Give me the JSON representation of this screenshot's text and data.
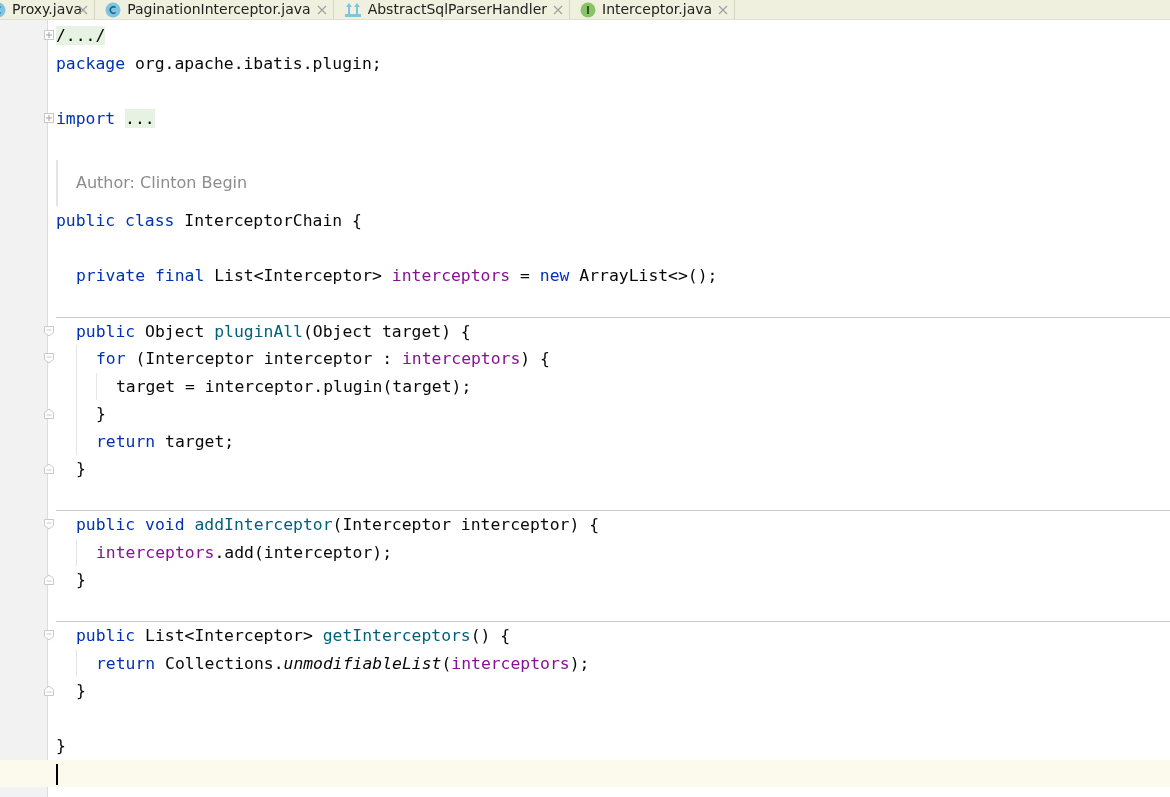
{
  "tabs": [
    {
      "label": "Proxy.java",
      "kind": "class"
    },
    {
      "label": "PaginationInterceptor.java",
      "kind": "class"
    },
    {
      "label": "AbstractSqlParserHandler",
      "kind": "abstract_class"
    },
    {
      "label": "Interceptor.java",
      "kind": "interface"
    }
  ],
  "lines": [
    {
      "kind": "folded",
      "tokens": [
        {
          "t": "/.../",
          "kind": "placeholder"
        }
      ]
    },
    {
      "kind": "code",
      "tokens": [
        {
          "t": "package",
          "kind": "keyword"
        },
        {
          "t": " org.apache.ibatis.plugin;",
          "kind": "plain"
        }
      ]
    },
    {
      "kind": "blank"
    },
    {
      "kind": "folded",
      "tokens": [
        {
          "t": "import ",
          "kind": "keyword"
        },
        {
          "t": "...",
          "kind": "placeholder"
        }
      ]
    },
    {
      "kind": "blank"
    },
    {
      "kind": "doc",
      "text": "Author: Clinton Begin"
    },
    {
      "kind": "scope",
      "tokens": [
        {
          "t": "public class",
          "kind": "keyword"
        },
        {
          "t": " InterceptorChain {",
          "kind": "plain"
        }
      ],
      "end": [
        {
          "t": "}",
          "kind": "plain"
        }
      ],
      "children": [
        {
          "kind": "blank"
        },
        {
          "kind": "code",
          "tokens": [
            {
              "t": "private final",
              "kind": "keyword"
            },
            {
              "t": " List<Interceptor> ",
              "kind": "plain"
            },
            {
              "t": "interceptors",
              "kind": "field"
            },
            {
              "t": " = ",
              "kind": "plain"
            },
            {
              "t": "new",
              "kind": "keyword"
            },
            {
              "t": " ArrayList<>();",
              "kind": "plain"
            }
          ]
        },
        {
          "kind": "blank"
        },
        {
          "kind": "separator"
        },
        {
          "kind": "block",
          "tokens": [
            {
              "t": "public",
              "kind": "keyword"
            },
            {
              "t": " Object ",
              "kind": "plain"
            },
            {
              "t": "pluginAll",
              "kind": "method"
            },
            {
              "t": "(Object target) {",
              "kind": "plain"
            }
          ],
          "end": [
            {
              "t": "}",
              "kind": "plain"
            }
          ],
          "children": [
            {
              "kind": "block",
              "tokens": [
                {
                  "t": "for",
                  "kind": "keyword"
                },
                {
                  "t": " (Interceptor interceptor : ",
                  "kind": "plain"
                },
                {
                  "t": "interceptors",
                  "kind": "field"
                },
                {
                  "t": ") {",
                  "kind": "plain"
                }
              ],
              "end": [
                {
                  "t": "}",
                  "kind": "plain"
                }
              ],
              "children": [
                {
                  "kind": "code",
                  "tokens": [
                    {
                      "t": "target = interceptor.plugin(target);",
                      "kind": "plain"
                    }
                  ]
                }
              ]
            },
            {
              "kind": "code",
              "tokens": [
                {
                  "t": "return",
                  "kind": "keyword"
                },
                {
                  "t": " target;",
                  "kind": "plain"
                }
              ]
            }
          ]
        },
        {
          "kind": "blank"
        },
        {
          "kind": "separator"
        },
        {
          "kind": "block",
          "tokens": [
            {
              "t": "public void ",
              "kind": "keyword"
            },
            {
              "t": "addInterceptor",
              "kind": "method"
            },
            {
              "t": "(Interceptor interceptor) {",
              "kind": "plain"
            }
          ],
          "end": [
            {
              "t": "}",
              "kind": "plain"
            }
          ],
          "children": [
            {
              "kind": "code",
              "tokens": [
                {
                  "t": "interceptors",
                  "kind": "field"
                },
                {
                  "t": ".add(interceptor);",
                  "kind": "plain"
                }
              ]
            }
          ]
        },
        {
          "kind": "blank"
        },
        {
          "kind": "separator"
        },
        {
          "kind": "block",
          "tokens": [
            {
              "t": "public",
              "kind": "keyword"
            },
            {
              "t": " List<Interceptor> ",
              "kind": "plain"
            },
            {
              "t": "getInterceptors",
              "kind": "method"
            },
            {
              "t": "() {",
              "kind": "plain"
            }
          ],
          "end": [
            {
              "t": "}",
              "kind": "plain"
            }
          ],
          "children": [
            {
              "kind": "code",
              "tokens": [
                {
                  "t": "return",
                  "kind": "keyword"
                },
                {
                  "t": " Collections.",
                  "kind": "plain"
                },
                {
                  "t": "unmodifiableList",
                  "kind": "static_call"
                },
                {
                  "t": "(",
                  "kind": "plain"
                },
                {
                  "t": "interceptors",
                  "kind": "field"
                },
                {
                  "t": ");",
                  "kind": "plain"
                }
              ]
            }
          ]
        },
        {
          "kind": "blank"
        }
      ]
    },
    {
      "kind": "cursor"
    }
  ]
}
